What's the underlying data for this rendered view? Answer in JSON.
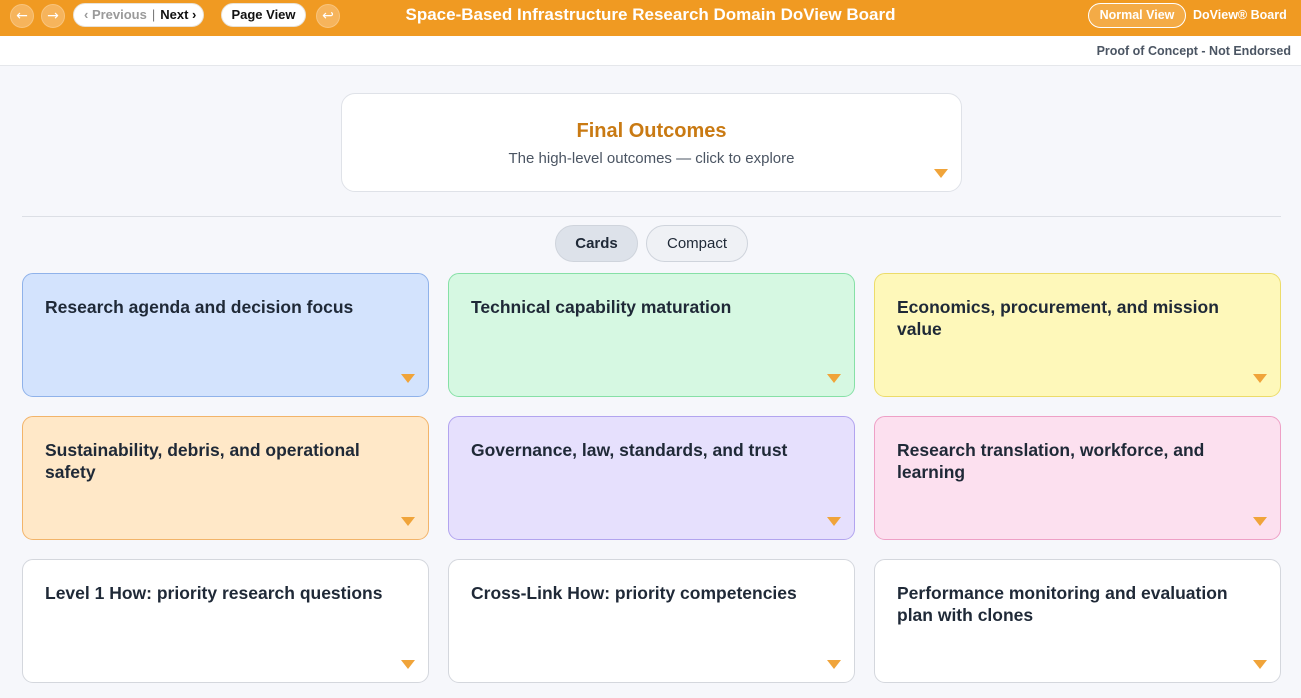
{
  "toolbar": {
    "back_icon": "arrow-left-icon",
    "forward_icon": "arrow-right-icon",
    "previous_label": "‹ Previous",
    "separator": "|",
    "next_label": "Next ›",
    "page_view_label": "Page View",
    "return_icon": "return-arrow-icon",
    "normal_view_label": "Normal View",
    "brand": "DoView® Board"
  },
  "app_title": "Space-Based Infrastructure Research Domain DoView Board",
  "disclaimer": "Proof of Concept - Not Endorsed",
  "final_outcomes": {
    "title": "Final Outcomes",
    "subtitle": "The high-level outcomes — click to explore"
  },
  "view_toggle": {
    "cards_label": "Cards",
    "compact_label": "Compact",
    "selected": "Cards"
  },
  "cards": [
    {
      "label": "Research agenda and decision focus",
      "color": "#d3e3fd"
    },
    {
      "label": "Technical capability maturation",
      "color": "#d6f8e2"
    },
    {
      "label": "Economics, procurement, and mission value",
      "color": "#fef8ba"
    },
    {
      "label": "Sustainability, debris, and operational safety",
      "color": "#ffe8c8"
    },
    {
      "label": "Governance, law, standards, and trust",
      "color": "#e6e0fd"
    },
    {
      "label": "Research translation, workforce, and learning",
      "color": "#fce0ef"
    },
    {
      "label": "Level 1 How: priority research questions",
      "color": "#ffffff"
    },
    {
      "label": "Cross-Link How: priority competencies",
      "color": "#ffffff"
    },
    {
      "label": "Performance monitoring and evaluation plan with clones",
      "color": "#ffffff"
    }
  ],
  "colors": {
    "accent": "#f09a22",
    "final_title": "#c97a13",
    "caret": "#f0a43a"
  }
}
